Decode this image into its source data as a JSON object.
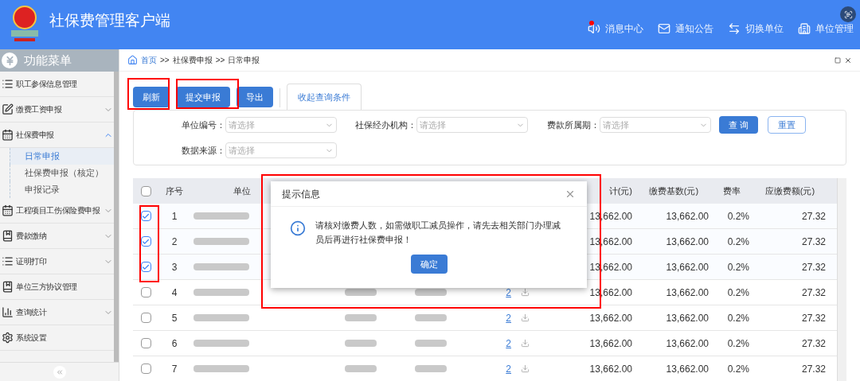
{
  "app": {
    "title": "社保费管理客户端"
  },
  "header_links": [
    {
      "label": "消息中心",
      "kind": "message",
      "unread": true
    },
    {
      "label": "通知公告",
      "kind": "mail",
      "unread": false
    },
    {
      "label": "切换单位",
      "kind": "switch",
      "unread": false
    },
    {
      "label": "单位管理",
      "kind": "building",
      "unread": false
    }
  ],
  "sidebar": {
    "title": "功能菜单",
    "items": [
      {
        "label": "职工参保信息管理",
        "kind": "link"
      },
      {
        "label": "缴费工资申报",
        "kind": "group",
        "expanded": false
      },
      {
        "label": "社保费申报",
        "kind": "group",
        "expanded": true,
        "children": [
          {
            "label": "日常申报",
            "selected": true
          },
          {
            "label": "社保费申报（核定）",
            "selected": false
          },
          {
            "label": "申报记录",
            "selected": false
          }
        ]
      },
      {
        "label": "工程项目工伤保险费申报",
        "kind": "group",
        "expanded": false
      },
      {
        "label": "费款缴纳",
        "kind": "group",
        "expanded": false
      },
      {
        "label": "证明打印",
        "kind": "group",
        "expanded": false
      },
      {
        "label": "单位三方协议管理",
        "kind": "link"
      },
      {
        "label": "查询统计",
        "kind": "group",
        "expanded": false
      },
      {
        "label": "系统设置",
        "kind": "link"
      }
    ]
  },
  "breadcrumb": {
    "items": [
      "首页",
      "社保费申报",
      "日常申报"
    ],
    "separator": ">>"
  },
  "toolbar": {
    "buttons": [
      "刷新",
      "提交申报",
      "导出"
    ],
    "tab": "收起查询条件"
  },
  "filters": [
    {
      "label": "单位编号：",
      "placeholder": "请选择"
    },
    {
      "label": "社保经办机构：",
      "placeholder": "请选择"
    },
    {
      "label": "费款所属期：",
      "placeholder": "请选择"
    },
    {
      "label": "数据来源：",
      "placeholder": "请选择"
    }
  ],
  "filter_buttons": [
    {
      "label": "查 询",
      "kind": "primary"
    },
    {
      "label": "重置",
      "kind": "outline"
    }
  ],
  "table": {
    "all_checked": false,
    "columns": [
      "序号",
      "单位",
      "计(元)",
      "缴费基数(元)",
      "费率",
      "应缴费额(元)"
    ],
    "rows": [
      {
        "checked": true,
        "index": "1",
        "amount": "13,662.00",
        "base": "13,662.00",
        "rate": "0.2%",
        "due": "27.32"
      },
      {
        "checked": true,
        "index": "2",
        "amount": "13,662.00",
        "base": "13,662.00",
        "rate": "0.2%",
        "due": "27.32"
      },
      {
        "checked": true,
        "index": "3",
        "amount": "13,662.00",
        "base": "13,662.00",
        "rate": "0.2%",
        "due": "27.32"
      },
      {
        "checked": false,
        "index": "4",
        "count": "2",
        "amount": "13,662.00",
        "base": "13,662.00",
        "rate": "0.2%",
        "due": "27.32"
      },
      {
        "checked": false,
        "index": "5",
        "count": "2",
        "amount": "13,662.00",
        "base": "13,662.00",
        "rate": "0.2%",
        "due": "27.32"
      },
      {
        "checked": false,
        "index": "6",
        "count": "2",
        "amount": "13,662.00",
        "base": "13,662.00",
        "rate": "0.2%",
        "due": "27.32"
      },
      {
        "checked": false,
        "index": "7",
        "count": "2",
        "amount": "13,662.00",
        "base": "13,662.00",
        "rate": "0.2%",
        "due": "27.32"
      }
    ]
  },
  "dialog": {
    "title": "提示信息",
    "message": "请核对缴费人数，如需做职工减员操作，请先去相关部门办理减员后再进行社保费申报！",
    "button": "确定"
  }
}
